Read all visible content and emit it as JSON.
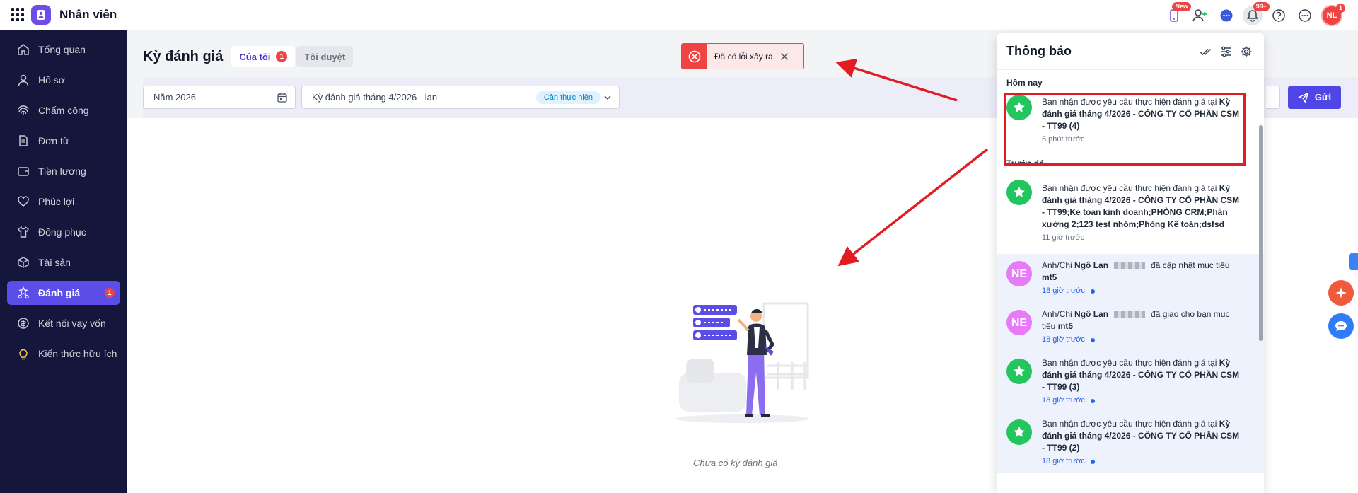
{
  "app": {
    "title": "Nhân viên",
    "new_badge": "New",
    "bell_badge": "99+",
    "avatar_initials": "NL",
    "avatar_badge": "1"
  },
  "sidebar": {
    "items": [
      {
        "label": "Tổng quan",
        "icon": "home-icon"
      },
      {
        "label": "Hồ sơ",
        "icon": "user-icon"
      },
      {
        "label": "Chấm công",
        "icon": "fingerprint-icon"
      },
      {
        "label": "Đơn từ",
        "icon": "document-icon"
      },
      {
        "label": "Tiền lương",
        "icon": "wallet-icon"
      },
      {
        "label": "Phúc lợi",
        "icon": "heart-hand-icon"
      },
      {
        "label": "Đồng phục",
        "icon": "shirt-icon"
      },
      {
        "label": "Tài sản",
        "icon": "box-icon"
      },
      {
        "label": "Đánh giá",
        "icon": "stars-icon",
        "badge": "1",
        "active": true
      },
      {
        "label": "Kết nối vay vốn",
        "icon": "loan-icon"
      },
      {
        "label": "Kiến thức hữu ích",
        "icon": "bulb-icon"
      }
    ]
  },
  "main": {
    "title": "Kỳ đánh giá",
    "tabs": [
      {
        "label": "Của tôi",
        "badge": "1"
      },
      {
        "label": "Tôi duyệt"
      }
    ],
    "year_field": "Năm 2026",
    "period_field": "Kỳ đánh giá tháng 4/2026 - lan",
    "period_status": "Cần thực hiện",
    "send_label": "Gửi",
    "empty_text": "Chưa có kỳ đánh giá"
  },
  "toast": {
    "message": "Đã có lỗi xảy ra"
  },
  "notifications": {
    "title": "Thông báo",
    "today_label": "Hôm nay",
    "earlier_label": "Trước đó",
    "today": [
      {
        "text": "Bạn nhận được yêu cầu thực hiện đánh giá tại ",
        "bold": "Kỳ đánh giá tháng 4/2026 - CÔNG TY CỔ PHẦN CSM - TT99 (4)",
        "time": "5 phút trước"
      }
    ],
    "earlier": [
      {
        "text": "Bạn nhận được yêu cầu thực hiện đánh giá tại ",
        "bold": "Kỳ đánh giá tháng 4/2026 - CÔNG TY CỔ PHẦN CSM - TT99;Ke toan kinh doanh;PHÒNG CRM;Phân xưởng 2;123 test nhóm;Phòng Kế toán;dsfsd",
        "time": "11 giờ trước"
      },
      {
        "initials": "NE",
        "pre": "Anh/Chị ",
        "name": "Ngô Lan",
        "mid": "đã cập nhật mục tiêu ",
        "target": "mt5",
        "time": "18 giờ trước"
      },
      {
        "initials": "NE",
        "pre": "Anh/Chị ",
        "name": "Ngô Lan",
        "mid": "đã giao cho bạn mục tiêu ",
        "target": "mt5",
        "time": "18 giờ trước"
      },
      {
        "text": "Bạn nhận được yêu cầu thực hiện đánh giá tại ",
        "bold": "Kỳ đánh giá tháng 4/2026 - CÔNG TY CỔ PHẦN CSM - TT99 (3)",
        "time": "18 giờ trước"
      },
      {
        "text": "Bạn nhận được yêu cầu thực hiện đánh giá tại ",
        "bold": "Kỳ đánh giá tháng 4/2026 - CÔNG TY CỔ PHẦN CSM - TT99 (2)",
        "time": "18 giờ trước"
      }
    ]
  },
  "colors": {
    "sidebar_bg": "#15163b",
    "accent": "#5b4ee6",
    "error": "#ef4444",
    "annotation_red": "#e11d24"
  }
}
